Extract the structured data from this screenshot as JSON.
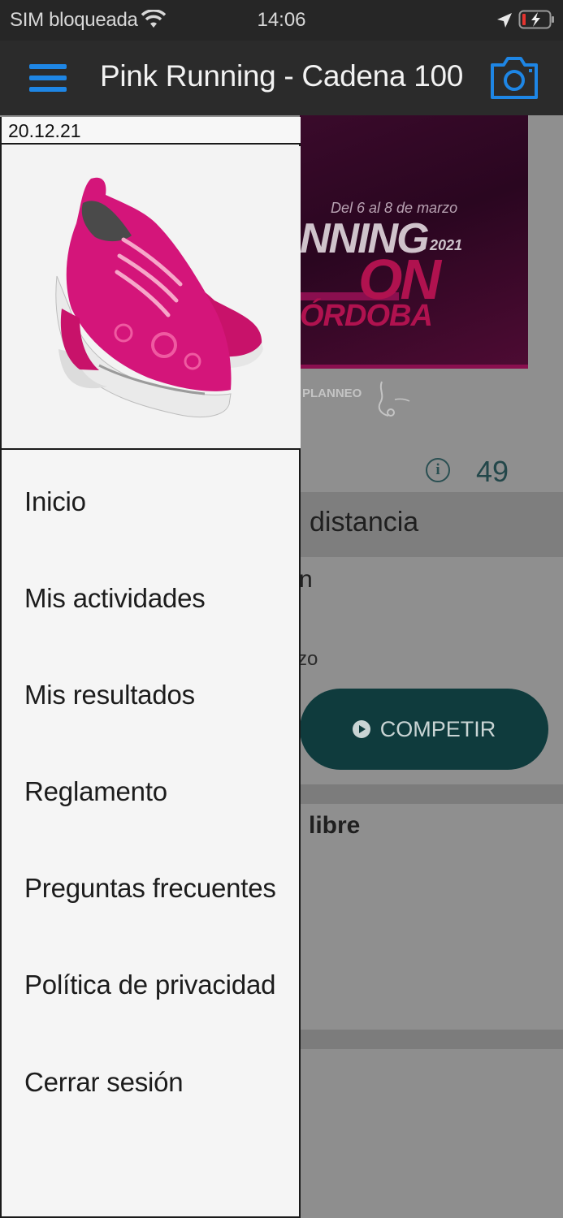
{
  "status_bar": {
    "carrier": "SIM bloqueada",
    "time": "14:06"
  },
  "nav": {
    "title": "Pink Running - Cadena 100"
  },
  "drawer": {
    "date": "20.12.21",
    "items": [
      {
        "label": "Inicio"
      },
      {
        "label": "Mis actividades"
      },
      {
        "label": "Mis resultados"
      },
      {
        "label": "Reglamento"
      },
      {
        "label": "Preguntas frecuentes"
      },
      {
        "label": "Política de privacidad"
      },
      {
        "label": "Cerrar sesión"
      }
    ]
  },
  "background": {
    "banner": {
      "dates": "Del 6 al 8 de marzo",
      "word_fragment": "NNING",
      "year": "2021",
      "on": "ON",
      "city_fragment": "ÓRDOBA"
    },
    "sponsor": "PLANNEO",
    "count": "49",
    "section1_fragment": "distancia",
    "fragment_a": "n",
    "fragment_b": "zo",
    "compete_label": "COMPETIR",
    "section2_fragment": "libre"
  },
  "colors": {
    "accent_blue": "#1e86e5",
    "brand_pink": "#e0197a",
    "compete_teal": "#0f3b3d"
  }
}
